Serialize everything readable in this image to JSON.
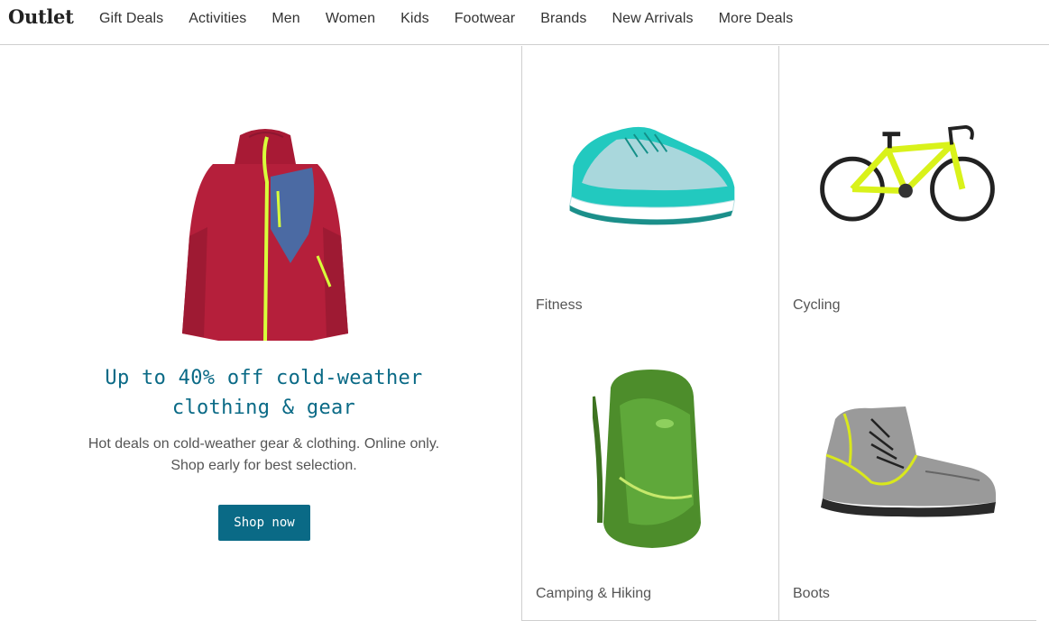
{
  "header": {
    "logo": "Outlet",
    "nav": [
      "Gift Deals",
      "Activities",
      "Men",
      "Women",
      "Kids",
      "Footwear",
      "Brands",
      "New Arrivals",
      "More Deals"
    ]
  },
  "hero": {
    "title_line1": "Up to 40% off cold-weather",
    "title_line2": "clothing & gear",
    "desc_line1": "Hot deals on cold-weather gear & clothing. Online only.",
    "desc_line2": "Shop early for best selection.",
    "button": "Shop now",
    "image_icon": "red-jacket-image"
  },
  "categories": [
    {
      "label": "Fitness",
      "icon": "running-shoe-image"
    },
    {
      "label": "Cycling",
      "icon": "bicycle-image"
    },
    {
      "label": "Camping & Hiking",
      "icon": "backpack-image"
    },
    {
      "label": "Boots",
      "icon": "hiking-boot-image"
    }
  ],
  "colors": {
    "accent": "#0a6a86",
    "jacket": "#b51f3b",
    "jacket_panel": "#4b6aa3",
    "zipper": "#d8ff3a",
    "shoe": "#22c9bf",
    "bike": "#d9f21a",
    "pack": "#4d8d2b"
  }
}
